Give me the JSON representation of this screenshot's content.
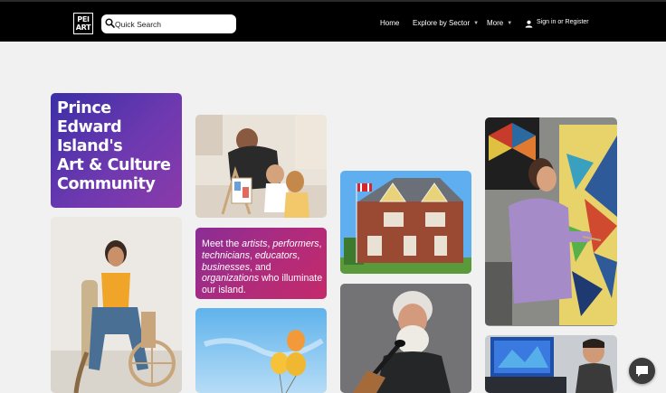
{
  "header": {
    "logo_text": "PEI ART",
    "search": {
      "placeholder": "Quick Search"
    },
    "nav": [
      {
        "label": "Home"
      },
      {
        "label": "Explore by Sector",
        "has_dropdown": true
      },
      {
        "label": "More",
        "has_dropdown": true
      }
    ],
    "signin": {
      "sign_in": "Sign in",
      "or": "or",
      "register": "Register"
    }
  },
  "hero": {
    "title_lines": [
      "Prince",
      "Edward",
      "Island's",
      "Art & Culture",
      "Community"
    ],
    "intro": {
      "meet": "Meet the ",
      "artists": "artists",
      "comma1": ", ",
      "performers": "performers",
      "comma2": ", ",
      "technicians": "technicians",
      "comma3": ", ",
      "educators": "educators",
      "comma4": ", ",
      "businesses": "businesses",
      "and": ", and ",
      "organizations": "organizations",
      "tail": " who illuminate our island."
    }
  },
  "colors": {
    "header_bg": "#000000",
    "page_bg": "#f1f1f1",
    "title_gradient": [
      "#3a2fa7",
      "#8a3aa8"
    ],
    "intro_gradient": [
      "#8a2d96",
      "#c42a6a"
    ]
  },
  "icons": {
    "search": "search-icon",
    "user": "user-icon",
    "chevron": "chevron-down-icon",
    "chat": "chat-bubble-icon"
  }
}
